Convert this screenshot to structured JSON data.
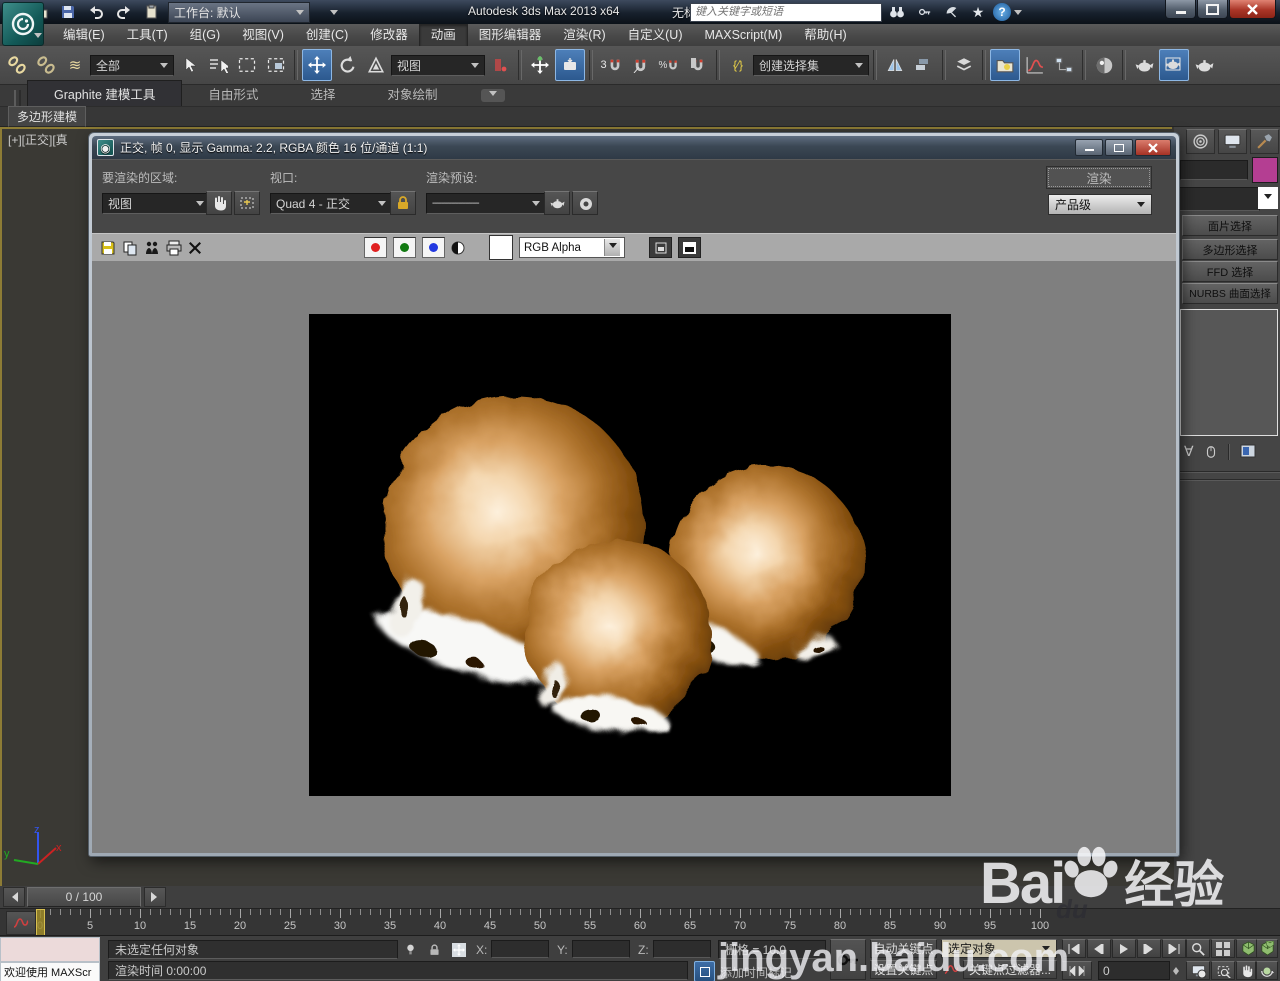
{
  "app": {
    "title": "Autodesk 3ds Max  2013 x64",
    "doc_title": "无标题",
    "workspace": "工作台: 默认",
    "search_placeholder": "键入关键字或短语"
  },
  "menus": [
    "编辑(E)",
    "工具(T)",
    "组(G)",
    "视图(V)",
    "创建(C)",
    "修改器",
    "动画",
    "图形编辑器",
    "渲染(R)",
    "自定义(U)",
    "MAXScript(M)",
    "帮助(H)"
  ],
  "toolbar": {
    "selection_filter": "全部",
    "reference_coord": "视图",
    "named_sets": "创建选择集",
    "snap_label": "3"
  },
  "ribbon": {
    "tabs": [
      "Graphite 建模工具",
      "自由形式",
      "选择",
      "对象绘制"
    ],
    "panel_tab": "多边形建模"
  },
  "viewport": {
    "label": "[+][正交][真",
    "axis_x": "x",
    "axis_y": "y",
    "axis_z": "z"
  },
  "render_window": {
    "title": "正交, 帧 0, 显示 Gamma: 2.2, RGBA 颜色 16 位/通道 (1:1)",
    "area_label": "要渲染的区域:",
    "area_value": "视图",
    "viewport_label": "视口:",
    "viewport_value": "Quad 4 - 正交",
    "preset_label": "渲染预设:",
    "preset_value": "--------------------",
    "render_button": "渲染",
    "render_mode": "产品级",
    "channel_display": "RGB Alpha"
  },
  "command_panel": {
    "modifier_buttons": [
      "面片选择",
      "多边形选择",
      "FFD 选择",
      "NURBS 曲面选择"
    ]
  },
  "timeline": {
    "frame_display": "0 / 100",
    "start": 0,
    "end": 100,
    "label_step": 5,
    "current_frame": 0
  },
  "status_bar": {
    "listener_text": "欢迎使用  MAXScr",
    "prompt": "未选定任何对象",
    "x_label": "X:",
    "y_label": "Y:",
    "z_label": "Z:",
    "grid": "栅格 = 10.0",
    "render_time": "渲染时间  0:00:00",
    "add_time_tag": "添加时间标记",
    "auto_key": "自动关键点",
    "set_key": "设置关键点",
    "key_filter_target": "选定对象",
    "key_filters": "关键点过滤器...",
    "frame_field": "0"
  },
  "watermark": {
    "brand_prefix": "Bai",
    "brand_du": "du",
    "brand_suffix": "经验",
    "url": "jingyan.baidu.com"
  },
  "colors": {
    "magenta_swatch": "#b43e92",
    "highlight_blue": "#35648f",
    "gold_border": "#8d7c35"
  }
}
